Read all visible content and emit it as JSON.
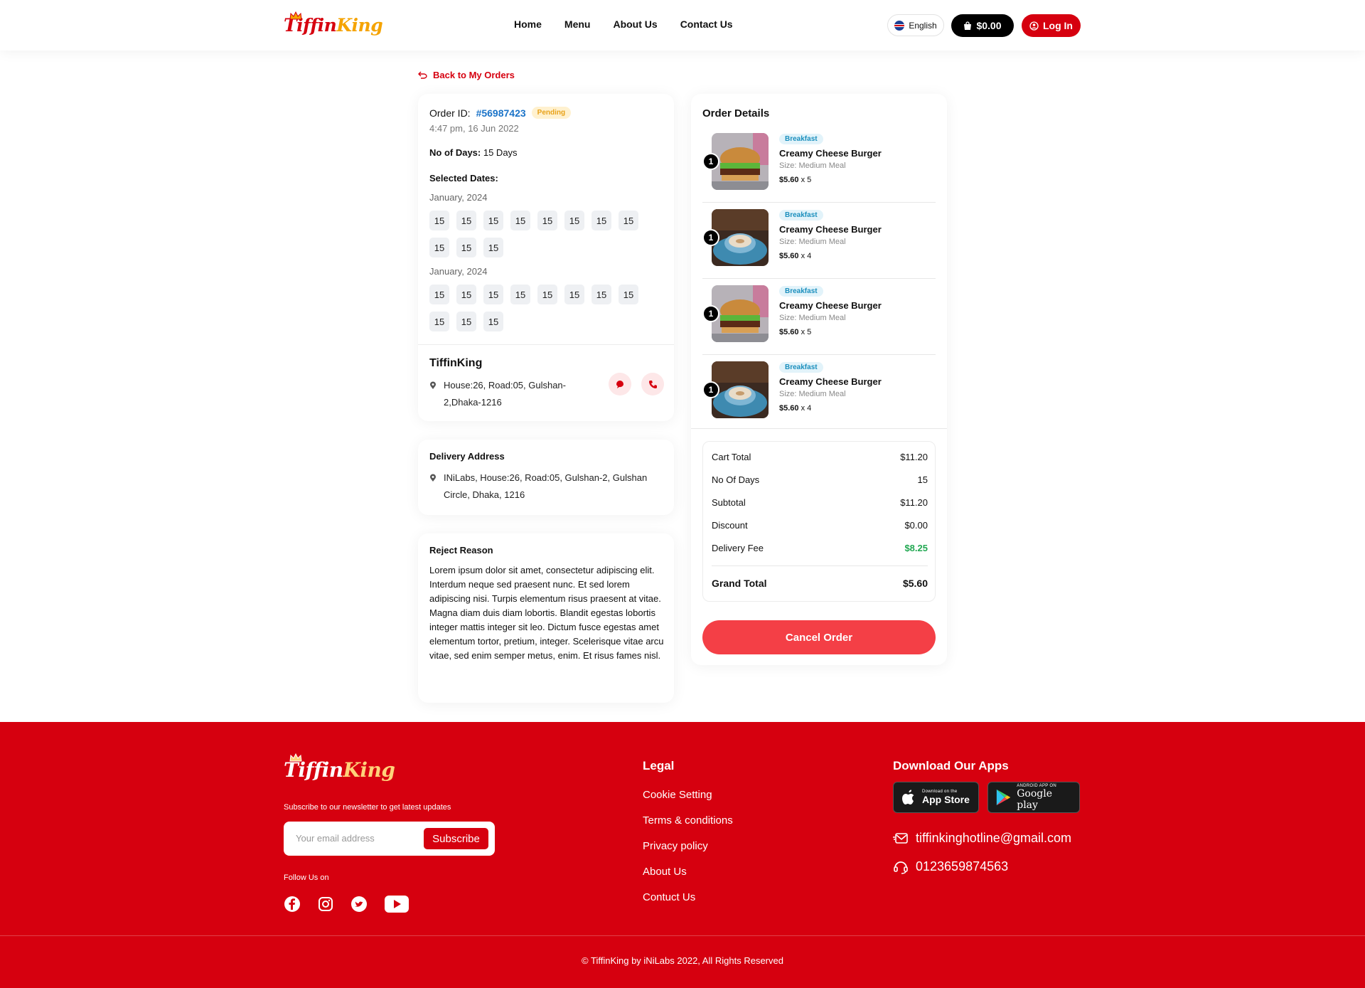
{
  "header": {
    "logo_part1": "Tiffin",
    "logo_part2": "King",
    "nav": [
      "Home",
      "Menu",
      "About Us",
      "Contact Us"
    ],
    "language": "English",
    "cart_total": "$0.00",
    "login_label": "Log In"
  },
  "back_label": "Back to My Orders",
  "order": {
    "id_label": "Order ID:",
    "id": "#56987423",
    "status": "Pending",
    "time": "4:47 pm, 16 Jun 2022",
    "days_label": "No of Days:",
    "days_value": "15 Days",
    "selected_label": "Selected Dates:",
    "months": [
      {
        "name": "January, 2024",
        "dates": [
          "15",
          "15",
          "15",
          "15",
          "15",
          "15",
          "15",
          "15",
          "15",
          "15",
          "15"
        ]
      },
      {
        "name": "January, 2024",
        "dates": [
          "15",
          "15",
          "15",
          "15",
          "15",
          "15",
          "15",
          "15",
          "15",
          "15",
          "15"
        ]
      }
    ],
    "restaurant_name": "TiffinKing",
    "restaurant_address": "House:26, Road:05, Gulshan-2,Dhaka-1216"
  },
  "delivery": {
    "title": "Delivery Address",
    "address": "INiLabs, House:26, Road:05, Gulshan-2, Gulshan Circle, Dhaka, 1216"
  },
  "reject": {
    "title": "Reject Reason",
    "text": "Lorem ipsum dolor sit amet, consectetur adipiscing elit. Interdum neque sed praesent nunc. Et sed lorem adipiscing nisi. Turpis elementum risus praesent at vitae. Magna diam duis diam lobortis. Blandit egestas lobortis integer mattis integer sit leo. Dictum fusce egestas amet elementum tortor, pretium, integer. Scelerisque vitae arcu vitae, sed enim semper metus, enim. Et risus fames nisl."
  },
  "details": {
    "title": "Order Details",
    "items": [
      {
        "qty": "1",
        "tag": "Breakfast",
        "name": "Creamy Cheese Burger",
        "size": "Size: Medium Meal",
        "price": "$5.60",
        "mult": " x 5",
        "image": "burger"
      },
      {
        "qty": "1",
        "tag": "Breakfast",
        "name": "Creamy Cheese Burger",
        "size": "Size: Medium Meal",
        "price": "$5.60",
        "mult": " x 4",
        "image": "coffee"
      },
      {
        "qty": "1",
        "tag": "Breakfast",
        "name": "Creamy Cheese Burger",
        "size": "Size: Medium Meal",
        "price": "$5.60",
        "mult": " x 5",
        "image": "burger"
      },
      {
        "qty": "1",
        "tag": "Breakfast",
        "name": "Creamy Cheese Burger",
        "size": "Size: Medium Meal",
        "price": "$5.60",
        "mult": " x 4",
        "image": "coffee"
      }
    ],
    "summary": [
      {
        "label": "Cart Total",
        "value": "$11.20"
      },
      {
        "label": "No Of Days",
        "value": "15"
      },
      {
        "label": "Subtotal",
        "value": "$11.20"
      },
      {
        "label": "Discount",
        "value": "$0.00"
      },
      {
        "label": "Delivery Fee",
        "value": "$8.25",
        "color": "#22a852"
      }
    ],
    "grand_total_label": "Grand Total",
    "grand_total_value": "$5.60",
    "cancel_label": "Cancel Order"
  },
  "footer": {
    "newsletter_text": "Subscribe to our newsletter to get latest updates",
    "email_placeholder": "Your email address",
    "subscribe_label": "Subscribe",
    "follow_label": "Follow Us on",
    "legal_title": "Legal",
    "legal_links": [
      "Cookie Setting",
      "Terms & conditions",
      "Privacy policy",
      "About Us",
      "Contuct Us"
    ],
    "apps_title": "Download Our Apps",
    "appstore_small": "Download on the",
    "appstore_big": "App Store",
    "googleplay_small": "ANDROID APP ON",
    "googleplay_big": "Google play",
    "email": "tiffinkinghotline@gmail.com",
    "phone": "0123659874563",
    "copyright": "© TiffinKing by iNiLabs 2022, All Rights Reserved"
  },
  "colors": {
    "brand": "#d6000f",
    "accent": "#f43f46",
    "link": "#1a73c8",
    "green": "#22a852"
  }
}
